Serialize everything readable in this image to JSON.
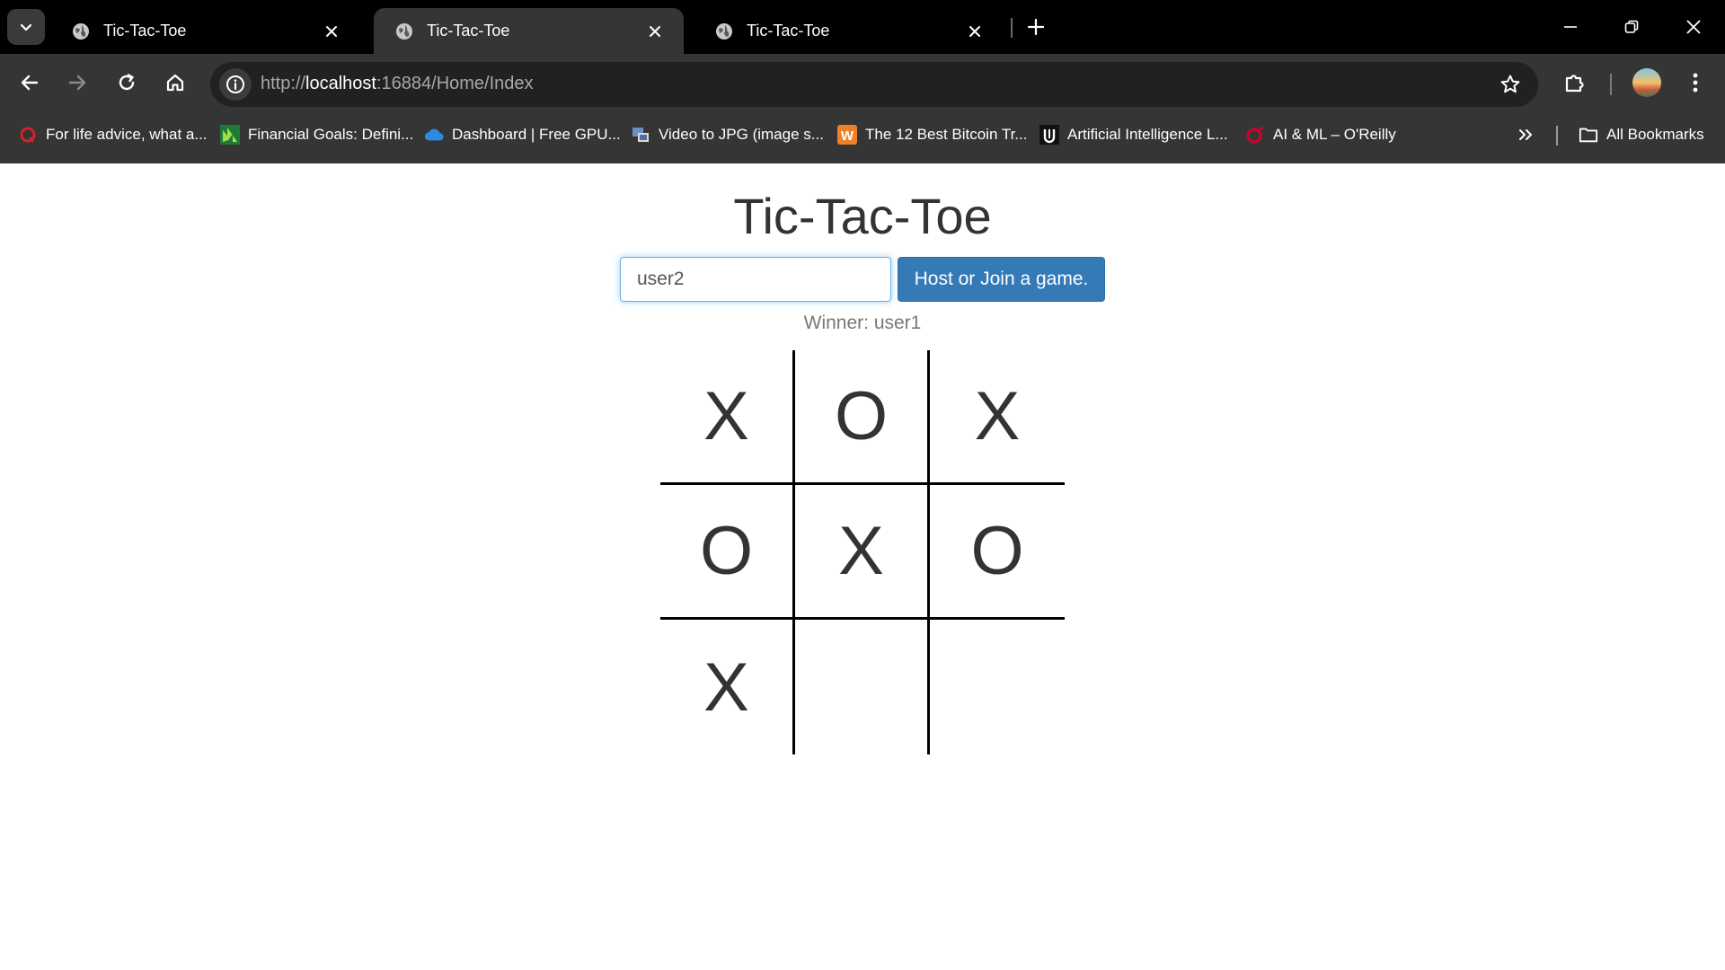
{
  "browser": {
    "tabs": [
      {
        "title": "Tic-Tac-Toe",
        "active": false
      },
      {
        "title": "Tic-Tac-Toe",
        "active": true
      },
      {
        "title": "Tic-Tac-Toe",
        "active": false
      }
    ],
    "url": {
      "scheme": "http://",
      "host": "localhost",
      "rest": ":16884/Home/Index"
    },
    "bookmarks": [
      {
        "label": "For life advice, what a...",
        "icon": "quora-icon",
        "color": "#b92b27"
      },
      {
        "label": "Financial Goals: Defini...",
        "icon": "investopedia-icon",
        "color": "#2ca84a"
      },
      {
        "label": "Dashboard | Free GPU...",
        "icon": "cloud-icon",
        "color": "#3b8ee8"
      },
      {
        "label": "Video to JPG (image s...",
        "icon": "converter-icon",
        "color": "#4f7fbf"
      },
      {
        "label": "The 12 Best Bitcoin Tr...",
        "icon": "w-icon",
        "color": "#ec7c2b"
      },
      {
        "label": "Artificial Intelligence L...",
        "icon": "u-icon",
        "color": "#222222"
      },
      {
        "label": "AI & ML – O'Reilly",
        "icon": "oreilly-icon",
        "color": "#d3002d"
      }
    ],
    "all_bookmarks_label": "All Bookmarks"
  },
  "game": {
    "title": "Tic-Tac-Toe",
    "name_input_value": "user2",
    "host_button_label": "Host or Join a game.",
    "status": "Winner: user1",
    "board": [
      [
        "X",
        "O",
        "X"
      ],
      [
        "O",
        "X",
        "O"
      ],
      [
        "X",
        "",
        ""
      ]
    ]
  }
}
